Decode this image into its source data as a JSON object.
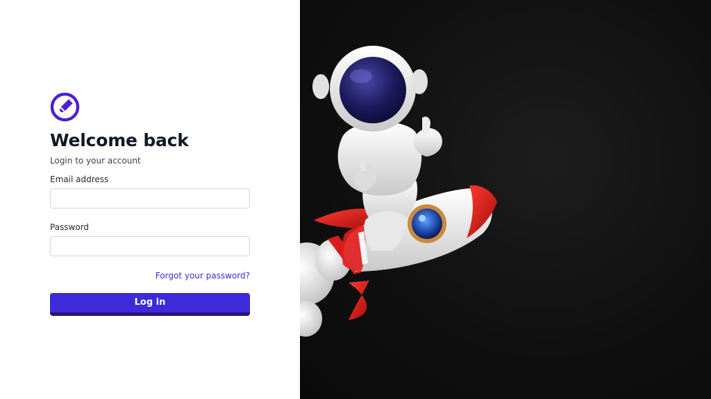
{
  "login": {
    "title": "Welcome back",
    "subtitle": "Login to your account",
    "email_label": "Email address",
    "email_value": "",
    "password_label": "Password",
    "password_value": "",
    "forgot_link": "Forgot your password?",
    "submit_label": "Log in"
  },
  "brand": {
    "accent": "#3d2bd9",
    "accent_dark": "#26147a",
    "logo_icon": "pencil-circle-icon"
  },
  "hero": {
    "background": "#0f0f0f",
    "illustration": "astronaut-on-rocket"
  }
}
